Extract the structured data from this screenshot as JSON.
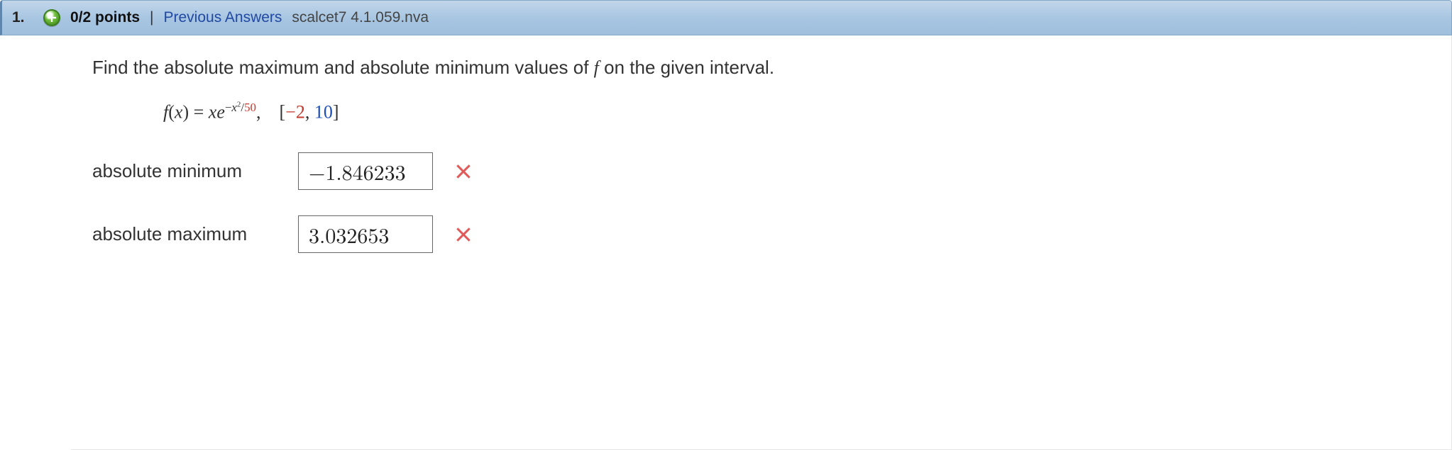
{
  "header": {
    "number": "1.",
    "points": "0/2 points",
    "separator": "|",
    "prev_link": "Previous Answers",
    "refcode": "scalcet7 4.1.059.nva"
  },
  "question": {
    "instructions_pre": "Find the absolute maximum and absolute minimum values of ",
    "instructions_var": "f",
    "instructions_post": " on the given interval.",
    "formula": {
      "lhs_var": "f",
      "lhs_paren_open": "(",
      "lhs_arg": "x",
      "lhs_paren_close": ") = ",
      "rhs_lead_x": "x",
      "rhs_e": "e",
      "exp_minus": "−",
      "exp_x": "x",
      "exp_sq": "2",
      "exp_slash": "/",
      "exp_denom": "50",
      "comma": ",    ",
      "interval_open": "[",
      "interval_a": "−2",
      "interval_sep": ", ",
      "interval_b": "10",
      "interval_close": "]"
    }
  },
  "answers": {
    "min": {
      "label": "absolute minimum",
      "value": "−1.846233",
      "status": "incorrect"
    },
    "max": {
      "label": "absolute maximum",
      "value": "3.032653",
      "status": "incorrect"
    }
  }
}
